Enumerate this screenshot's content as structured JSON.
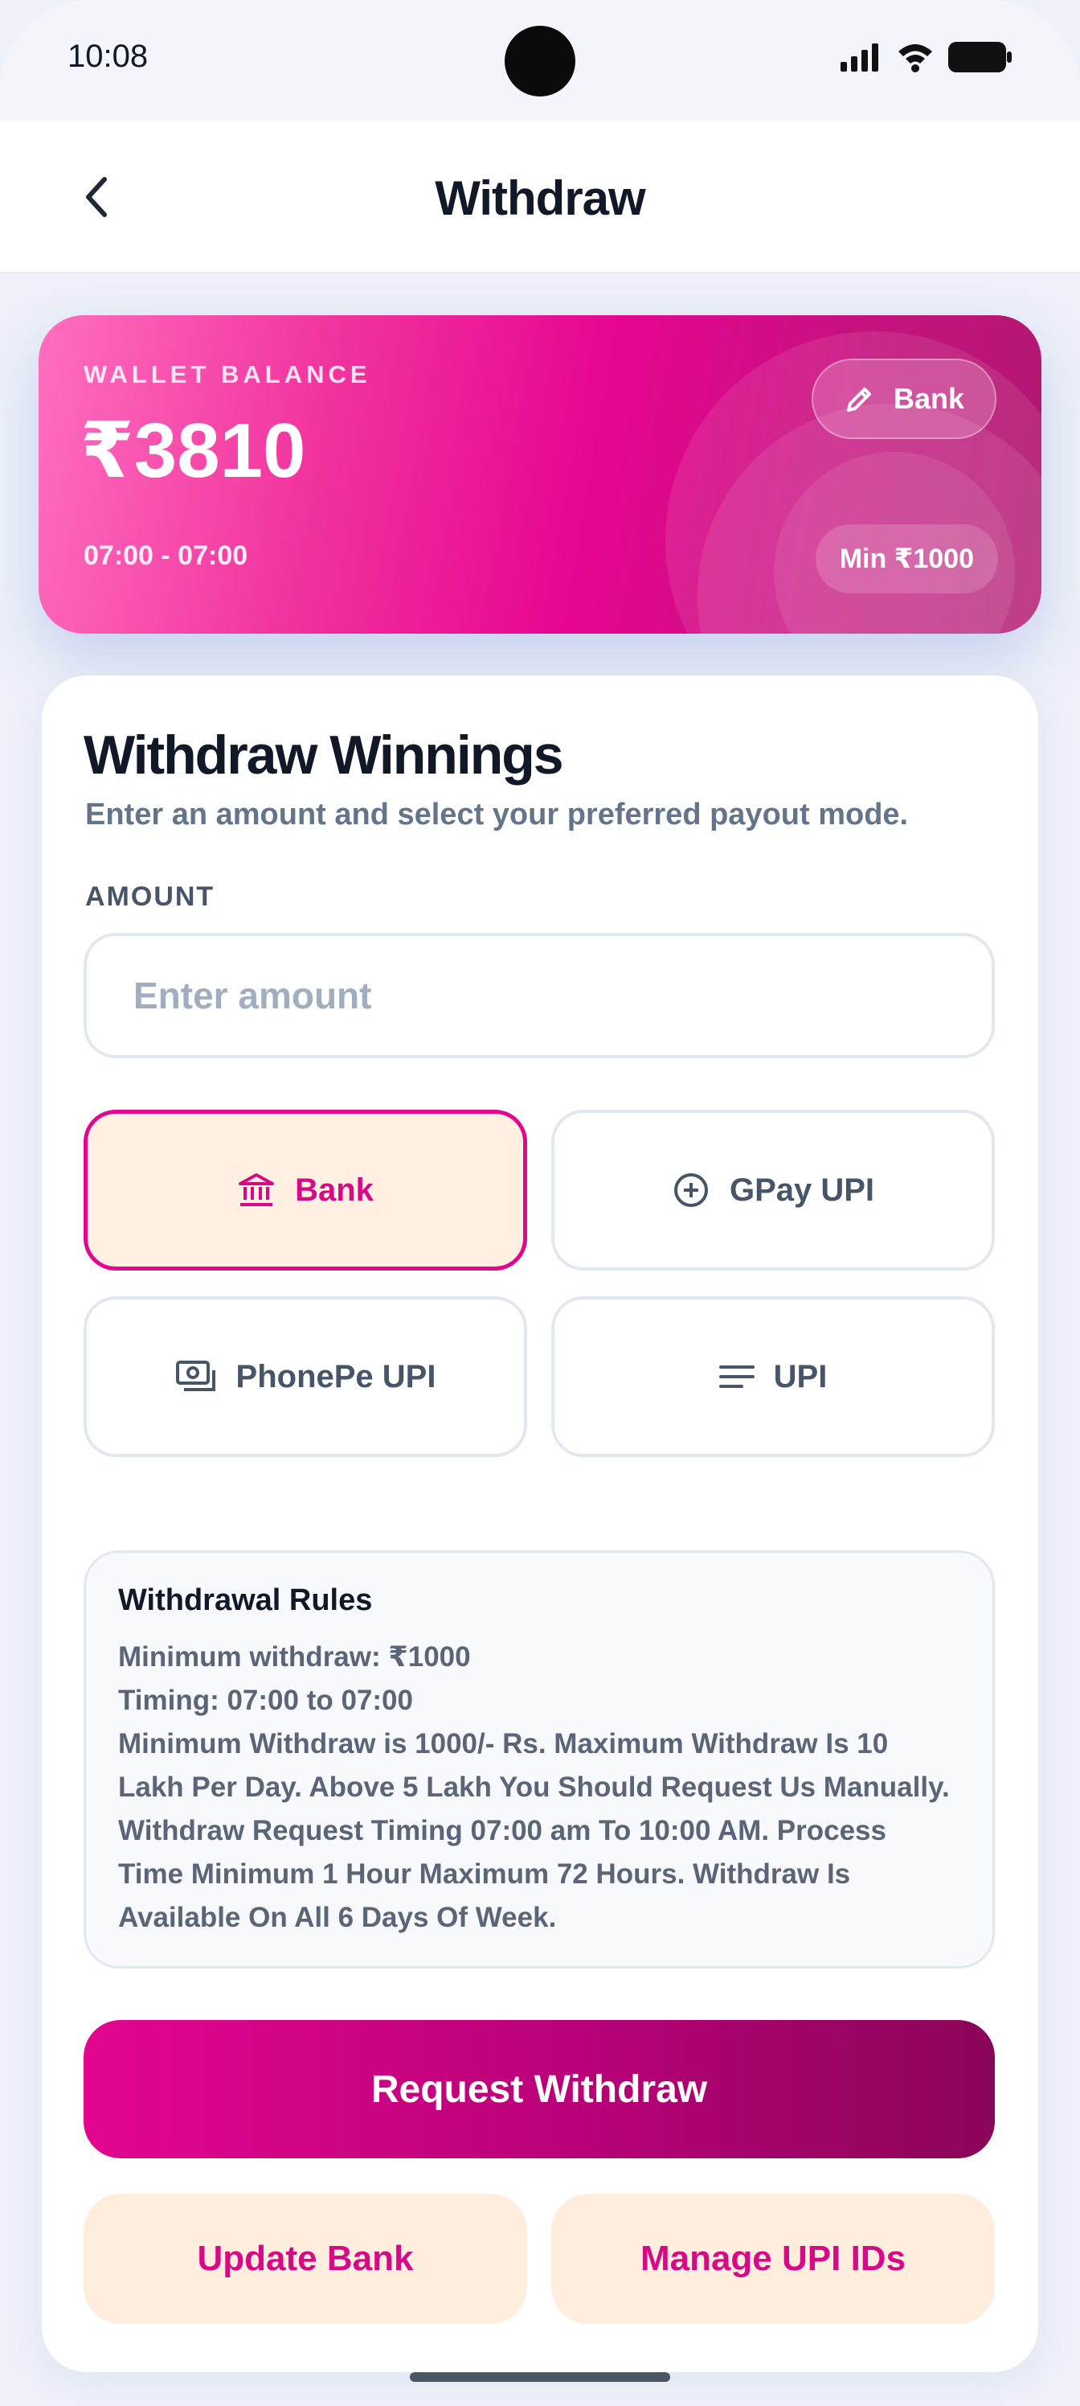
{
  "status_bar": {
    "time": "10:08"
  },
  "header": {
    "title": "Withdraw"
  },
  "wallet": {
    "label": "WALLET BALANCE",
    "amount": "₹3810",
    "timing": "07:00 - 07:00",
    "bank_button": "Bank",
    "min_label": "Min ₹1000",
    "gradient_colors": [
      "#ff6fbe",
      "#e60590",
      "#b0176f"
    ]
  },
  "form": {
    "title": "Withdraw Winnings",
    "subtitle": "Enter an amount and select your preferred payout mode.",
    "amount_label": "AMOUNT",
    "amount_placeholder": "Enter amount",
    "amount_value": "",
    "modes": [
      {
        "label": "Bank",
        "icon": "bank-icon",
        "selected": true
      },
      {
        "label": "GPay UPI",
        "icon": "plus-circle-icon",
        "selected": false
      },
      {
        "label": "PhonePe UPI",
        "icon": "cash-icon",
        "selected": false
      },
      {
        "label": "UPI",
        "icon": "lines-icon",
        "selected": false
      }
    ]
  },
  "rules": {
    "title": "Withdrawal Rules",
    "lines": [
      "Minimum withdraw: ₹1000",
      "Timing: 07:00 to 07:00",
      "Minimum Withdraw is 1000/- Rs. Maximum Withdraw Is 10",
      "Lakh Per Day. Above 5 Lakh You Should Request Us Manually.",
      "Withdraw Request Timing 07:00 am To 10:00 AM. Process",
      "Time Minimum 1 Hour Maximum 72 Hours. Withdraw Is",
      "Available On All 6 Days Of Week."
    ]
  },
  "actions": {
    "request": "Request Withdraw",
    "update_bank": "Update Bank",
    "manage_upi": "Manage UPI IDs"
  },
  "colors": {
    "accent": "#e3068f",
    "accent_dark": "#8a0558",
    "selected_bg": "#fff0e1",
    "secondary_btn_bg": "#ffeedd"
  }
}
